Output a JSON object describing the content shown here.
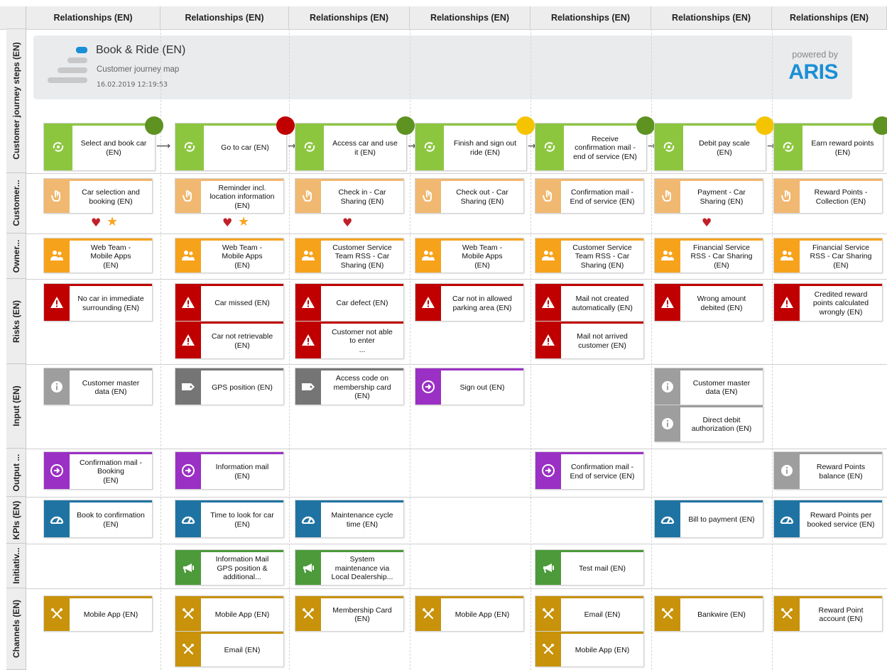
{
  "columns_label": "Relationships (EN)",
  "column_count": 7,
  "rows": [
    "Customer journey steps (EN)",
    "Customer...",
    "Owner...",
    "Risks (EN)",
    "Input (EN)",
    "Output ...",
    "KPIs (EN)",
    "Initiativ...",
    "Channels (EN)"
  ],
  "banner": {
    "title": "Book & Ride (EN)",
    "subtitle": "Customer journey map",
    "timestamp": "16.02.2019 12:19:53",
    "powered_by": "powered by",
    "brand": "ARIS"
  },
  "colors": {
    "step": "#8cc63f",
    "touchpoint": "#f0b870",
    "owner": "#f7a21b",
    "risk": "#c00000",
    "input_gray": "#9e9e9e",
    "input_dark": "#757575",
    "purple": "#9b30c4",
    "kpi": "#1f73a3",
    "initiative": "#4c9a3a",
    "channel": "#c8920a",
    "status_green": "#5e9221",
    "status_red": "#c00000",
    "status_yellow": "#f5c400",
    "heart": "#c0202a",
    "star": "#f5a623"
  },
  "steps": [
    {
      "text": "Select and book car\n(EN)",
      "status": "green"
    },
    {
      "text": "Go to car (EN)",
      "status": "red"
    },
    {
      "text": "Access car and use\nit (EN)",
      "status": "green"
    },
    {
      "text": "Finish and sign out\nride (EN)",
      "status": "yellow"
    },
    {
      "text": "Receive\nconfirmation mail -\nend of service (EN)",
      "status": "green"
    },
    {
      "text": "Debit pay scale\n(EN)",
      "status": "yellow"
    },
    {
      "text": "Earn reward points\n(EN)",
      "status": "green"
    }
  ],
  "touchpoints": [
    {
      "text": "Car selection and\nbooking (EN)",
      "heart": true,
      "star": true
    },
    {
      "text": "Reminder incl.\nlocation information\n(EN)",
      "heart": true,
      "star": true
    },
    {
      "text": "Check in - Car\nSharing (EN)",
      "heart": true,
      "star": false
    },
    {
      "text": "Check out - Car\nSharing (EN)",
      "heart": false,
      "star": false
    },
    {
      "text": "Confirmation mail -\nEnd of service (EN)",
      "heart": false,
      "star": false
    },
    {
      "text": "Payment - Car\nSharing (EN)",
      "heart": true,
      "star": false
    },
    {
      "text": "Reward Points -\nCollection (EN)",
      "heart": false,
      "star": false
    }
  ],
  "owners": [
    "Web Team -\nMobile Apps\n(EN)",
    "Web Team -\nMobile Apps\n(EN)",
    "Customer Service\nTeam RSS - Car\nSharing (EN)",
    "Web Team -\nMobile Apps\n(EN)",
    "Customer Service\nTeam RSS - Car\nSharing (EN)",
    "Financial Service\nRSS - Car Sharing\n(EN)",
    "Financial Service\nRSS - Car Sharing\n(EN)"
  ],
  "risks": [
    [
      "No car in immediate\nsurrounding (EN)"
    ],
    [
      "Car missed (EN)",
      "Car not retrievable\n(EN)"
    ],
    [
      "Car defect (EN)",
      "Customer not able\nto enter\n..."
    ],
    [
      "Car not in allowed\nparking area (EN)"
    ],
    [
      "Mail not created\nautomatically (EN)",
      "Mail not arrived\ncustomer (EN)"
    ],
    [
      "Wrong amount\ndebited (EN)"
    ],
    [
      "Credited reward\npoints calculated\nwrongly (EN)"
    ]
  ],
  "inputs": [
    [
      {
        "text": "Customer master\ndata (EN)",
        "kind": "info"
      }
    ],
    [
      {
        "text": "GPS position (EN)",
        "kind": "tag"
      }
    ],
    [
      {
        "text": "Access code on\nmembership card\n(EN)",
        "kind": "tag"
      }
    ],
    [
      {
        "text": "Sign out (EN)",
        "kind": "purple"
      }
    ],
    [],
    [
      {
        "text": "Customer master\ndata (EN)",
        "kind": "info"
      },
      {
        "text": "Direct debit\nauthorization (EN)",
        "kind": "info"
      }
    ],
    []
  ],
  "outputs": [
    {
      "text": "Confirmation mail -\nBooking\n(EN)",
      "kind": "purple"
    },
    {
      "text": "Information mail\n(EN)",
      "kind": "purple"
    },
    null,
    null,
    {
      "text": "Confirmation mail -\nEnd of service (EN)",
      "kind": "purple"
    },
    null,
    {
      "text": "Reward Points\nbalance (EN)",
      "kind": "info"
    }
  ],
  "kpis": [
    "Book to confirmation\n(EN)",
    "Time to look for car\n(EN)",
    "Maintenance cycle\ntime (EN)",
    null,
    null,
    "Bill to payment (EN)",
    "Reward Points per\nbooked service (EN)"
  ],
  "initiatives": [
    null,
    "Information Mail\nGPS position &\nadditional...",
    "System\nmaintenance via\nLocal Dealership...",
    null,
    "Test mail (EN)",
    null,
    null
  ],
  "channels": [
    [
      "Mobile App (EN)"
    ],
    [
      "Mobile App (EN)",
      "Email (EN)"
    ],
    [
      "Membership Card\n(EN)"
    ],
    [
      "Mobile App (EN)"
    ],
    [
      "Email (EN)",
      "Mobile App (EN)"
    ],
    [
      "Bankwire (EN)"
    ],
    [
      "Reward Point\naccount (EN)"
    ]
  ]
}
